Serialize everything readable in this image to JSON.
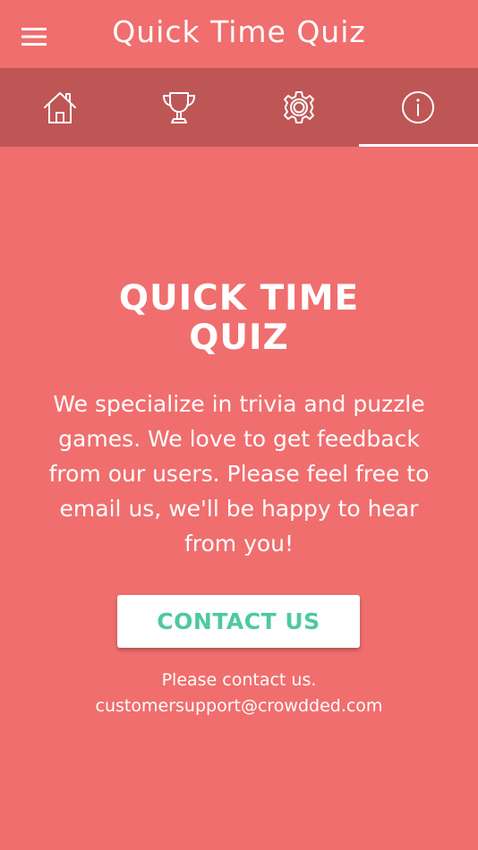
{
  "app": {
    "title": "Quick Time Quiz"
  },
  "header": {
    "menu_icon": "hamburger-menu-icon"
  },
  "tabs": [
    {
      "id": "home",
      "icon": "home-icon",
      "active": false
    },
    {
      "id": "leaderboard",
      "icon": "trophy-icon",
      "active": false
    },
    {
      "id": "settings",
      "icon": "gear-icon",
      "active": false
    },
    {
      "id": "about",
      "icon": "info-icon",
      "active": true
    }
  ],
  "about": {
    "title_line1": "QUICK TIME",
    "title_line2": "QUIZ",
    "description": "We specialize in trivia and puzzle games. We love to get feedback from our users. Please feel free to email us, we'll be happy to hear from you!",
    "contact_button_label": "CONTACT US",
    "contact_note": "Please contact us.",
    "contact_email": "customersupport@crowdded.com"
  },
  "colors": {
    "background": "#f06e6e",
    "tab_bar": "#bf5656",
    "text": "#ffffff",
    "contact_button_text": "#4ec9a0",
    "contact_button_bg": "#ffffff"
  }
}
